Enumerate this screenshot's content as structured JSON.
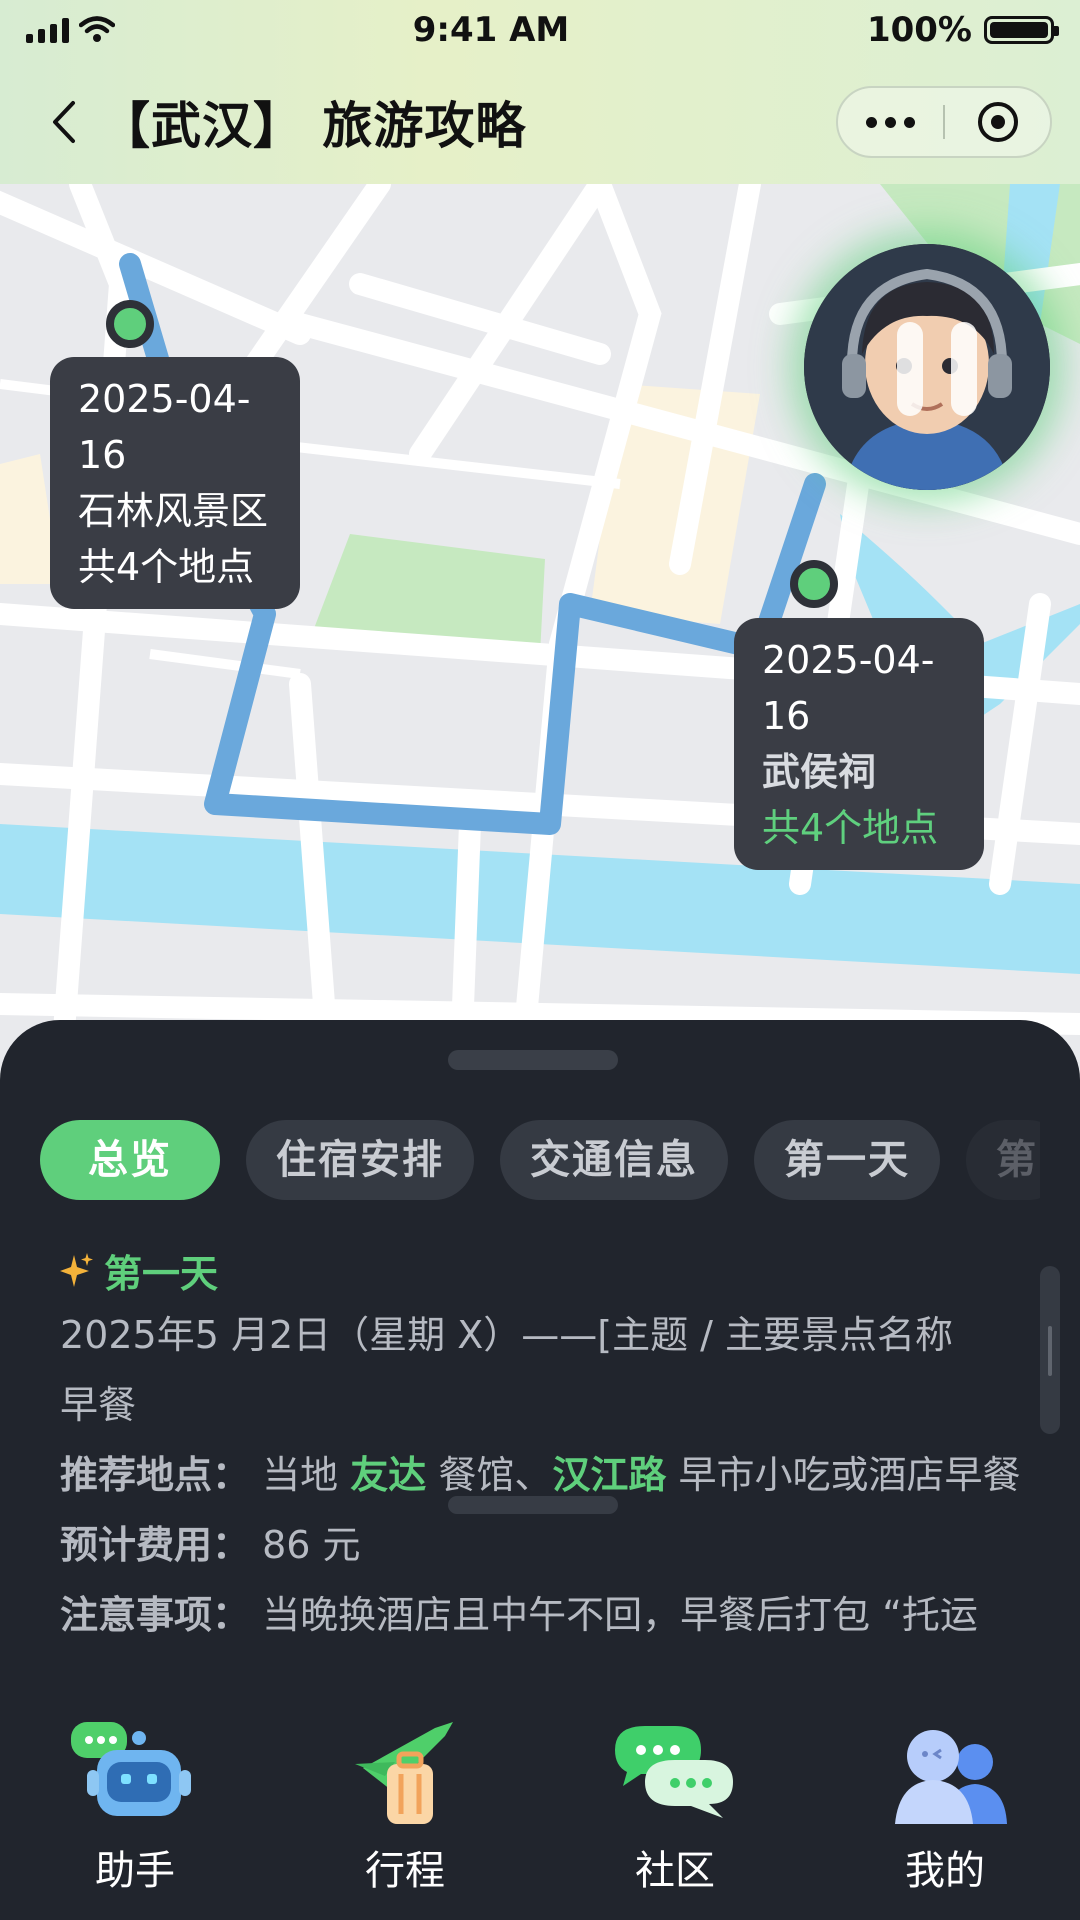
{
  "status_bar": {
    "time": "9:41 AM",
    "battery": "100%"
  },
  "navbar": {
    "title": "【武汉】 旅游攻略"
  },
  "map": {
    "markers": [
      {
        "date": "2025-04-16",
        "name": "石林风景区",
        "count": "共4个地点"
      },
      {
        "date": "2025-04-16",
        "name": "武侯祠",
        "count": "共4个地点"
      }
    ]
  },
  "tabs": [
    "总览",
    "住宿安排",
    "交通信息",
    "第一天",
    "第"
  ],
  "itinerary": {
    "day_title": "第一天",
    "date_line": "2025年5 月2日（星期 X）——[主题 / 主要景点名称",
    "meal": "早餐",
    "recommend_label": "推荐地点：",
    "recommend_pre": "当地",
    "recommend_hl1": "友达",
    "recommend_mid": "餐馆、",
    "recommend_hl2": "汉江路",
    "recommend_post": "早市小吃或酒店早餐",
    "cost_label": "预计费用：",
    "cost_value": "86 元",
    "notes_label": "注意事项：",
    "notes_value": "当晚换酒店且中午不回，早餐后打包 “托运"
  },
  "tabbar": {
    "items": [
      {
        "label": "助手",
        "icon": "assistant-robot-icon"
      },
      {
        "label": "行程",
        "icon": "itinerary-plane-luggage-icon"
      },
      {
        "label": "社区",
        "icon": "community-chat-icon"
      },
      {
        "label": "我的",
        "icon": "profile-people-icon"
      }
    ]
  },
  "colors": {
    "accent": "#5fcf7c",
    "dark_bg": "#21252d",
    "route": "#6aa8dc"
  }
}
